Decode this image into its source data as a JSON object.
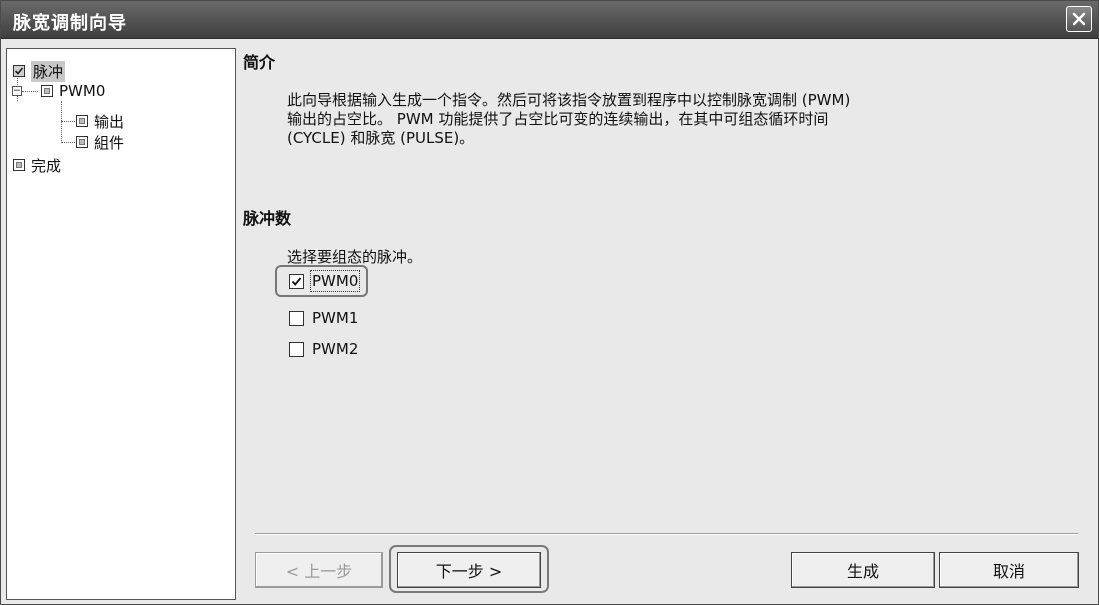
{
  "window": {
    "title": "脉宽调制向导"
  },
  "tree": {
    "items": [
      {
        "label": "脉冲",
        "checked": true,
        "selected": true
      },
      {
        "label": "PWM0",
        "checked": false
      },
      {
        "label": "输出",
        "checked": false
      },
      {
        "label": "組件",
        "checked": false
      },
      {
        "label": "完成",
        "checked": false
      }
    ]
  },
  "intro": {
    "heading": "简介",
    "lines": [
      "此向导根据输入生成一个指令。然后可将该指令放置到程序中以控制脉宽调制 (PWM)",
      "输出的占空比。 PWM 功能提供了占空比可变的连续输出，在其中可组态循环时间",
      "(CYCLE) 和脉宽 (PULSE)。"
    ]
  },
  "pulse": {
    "heading": "脉冲数",
    "prompt": "选择要组态的脉冲。",
    "options": [
      {
        "label": "PWM0",
        "checked": true
      },
      {
        "label": "PWM1",
        "checked": false
      },
      {
        "label": "PWM2",
        "checked": false
      }
    ]
  },
  "buttons": {
    "prev": "< 上一步",
    "next": "下一步 >",
    "generate": "生成",
    "cancel": "取消"
  }
}
